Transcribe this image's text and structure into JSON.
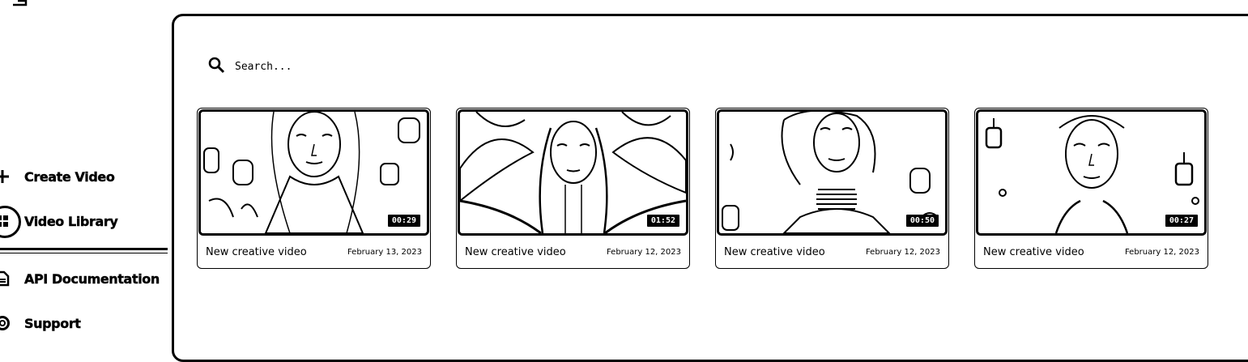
{
  "sidebar": {
    "items": [
      {
        "label": "Create Video",
        "icon": "plus-icon"
      },
      {
        "label": "Video Library",
        "icon": "grid-icon"
      },
      {
        "label": "API Documentation",
        "icon": "document-icon"
      },
      {
        "label": "Support",
        "icon": "lifebuoy-icon"
      }
    ]
  },
  "search": {
    "placeholder": "Search..."
  },
  "videos": [
    {
      "title": "New creative video",
      "date": "February 13, 2023",
      "duration": "00:29"
    },
    {
      "title": "New creative video",
      "date": "February 12, 2023",
      "duration": "01:52"
    },
    {
      "title": "New creative video",
      "date": "February 12, 2023",
      "duration": "00:50"
    },
    {
      "title": "New creative video",
      "date": "February 12, 2023",
      "duration": "00:27"
    }
  ]
}
